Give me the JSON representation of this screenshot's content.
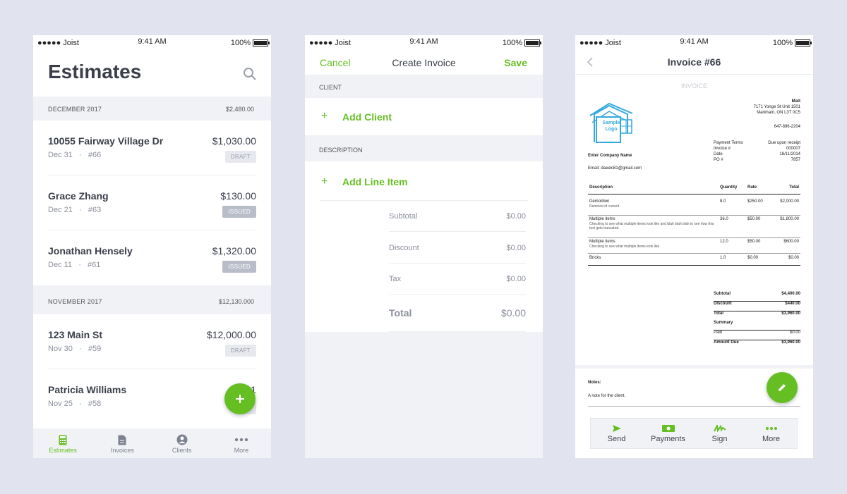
{
  "status_bar": {
    "carrier": "●●●●● Joist",
    "time": "9:41 AM",
    "battery": "100%"
  },
  "colors": {
    "accent": "#65bf23",
    "background": "#e1e3ee"
  },
  "estimates": {
    "title": "Estimates",
    "sections": [
      {
        "month": "DECEMBER 2017",
        "total": "$2,480.00",
        "items": [
          {
            "name": "10055 Fairway Village Dr",
            "date": "Dec 31",
            "number": "#66",
            "amount": "$1,030.00",
            "status": "DRAFT"
          },
          {
            "name": "Grace Zhang",
            "date": "Dec 21",
            "number": "#63",
            "amount": "$130.00",
            "status": "ISSUED"
          },
          {
            "name": "Jonathan Hensely",
            "date": "Dec 11",
            "number": "#61",
            "amount": "$1,320.00",
            "status": "ISSUED"
          }
        ]
      },
      {
        "month": "NOVEMBER 2017",
        "total": "$12,130.000",
        "items": [
          {
            "name": "123 Main St",
            "date": "Nov 30",
            "number": "#59",
            "amount": "$12,000.00",
            "status": "DRAFT"
          },
          {
            "name": "Patricia Williams",
            "date": "Nov 25",
            "number": "#58",
            "amount": "$1",
            "status": ""
          }
        ]
      }
    ],
    "fab_icon": "plus-icon",
    "tabs": [
      {
        "label": "Estimates",
        "icon": "calculator-icon"
      },
      {
        "label": "Invoices",
        "icon": "document-icon"
      },
      {
        "label": "Clients",
        "icon": "person-icon"
      },
      {
        "label": "More",
        "icon": "ellipsis-icon"
      }
    ]
  },
  "create_invoice": {
    "cancel": "Cancel",
    "title": "Create Invoice",
    "save": "Save",
    "client_label": "CLIENT",
    "add_client": "Add Client",
    "description_label": "DESCRIPTION",
    "add_line_item": "Add Line Item",
    "plus": "+",
    "subtotal_label": "Subtotal",
    "subtotal": "$0.00",
    "discount_label": "Discount",
    "discount": "$0.00",
    "tax_label": "Tax",
    "tax": "$0.00",
    "total_label": "Total",
    "total": "$0.00"
  },
  "invoice_view": {
    "title": "Invoice #66",
    "document": {
      "heading": "INVOICE",
      "logo_text": "Sample Logo",
      "company": "Enter Company Name",
      "email": "Email: daeeki81@gmail.com",
      "from_name": "Matt",
      "address1": "7171 Yonge St Unit 1501",
      "address2": "Markham, ON L3T 0C5",
      "phone": "647-896-2204",
      "terms": [
        {
          "k": "Payment Terms",
          "v": "Due upon receipt"
        },
        {
          "k": "Invoice #",
          "v": "000007"
        },
        {
          "k": "Date",
          "v": "18/11/2014"
        },
        {
          "k": "PO #",
          "v": "7857"
        }
      ],
      "columns": [
        "Description",
        "Quantity",
        "Rate",
        "Total"
      ],
      "lines": [
        {
          "desc": "Demolition",
          "sub": "Removal of current",
          "qty": "8.0",
          "rate": "$250.00",
          "total": "$2,000.00"
        },
        {
          "desc": "Multiple items",
          "sub": "Checking to see what multiple items look like and blah blah blah to see how this text gets truncated.",
          "qty": "36.0",
          "rate": "$50.00",
          "total": "$1,800.00"
        },
        {
          "desc": "Multiple items",
          "sub": "Checking to see what multiple items look like",
          "qty": "12.0",
          "rate": "$50.00",
          "total": "$600.00"
        },
        {
          "desc": "Bricks",
          "sub": "",
          "qty": "1.0",
          "rate": "$0.00",
          "total": "$0.00"
        }
      ],
      "totals": [
        {
          "k": "Subtotal",
          "v": "$4,400.00"
        },
        {
          "k": "Discount",
          "v": "$440.00"
        },
        {
          "k": "Total",
          "v": "$3,960.00"
        },
        {
          "k": "Summary",
          "v": ""
        },
        {
          "k": "Paid",
          "v": "$0.00"
        },
        {
          "k": "Amount Due",
          "v": "$3,960.00"
        }
      ]
    },
    "notes_label": "Notes:",
    "notes_text": "A note for the client.",
    "actions": [
      {
        "label": "Send",
        "icon": "send-icon"
      },
      {
        "label": "Payments",
        "icon": "cash-icon"
      },
      {
        "label": "Sign",
        "icon": "signature-icon"
      },
      {
        "label": "More",
        "icon": "ellipsis-icon"
      }
    ]
  }
}
